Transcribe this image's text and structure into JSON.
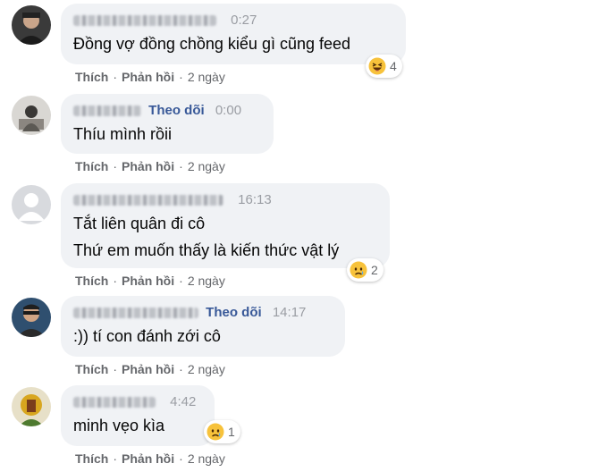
{
  "comments": [
    {
      "time": "0:27",
      "follow": "",
      "lines": [
        "Đồng vợ đồng chồng kiểu gì cũng feed"
      ],
      "reaction": {
        "icon": "laughing-emoji-icon",
        "count": "4"
      },
      "actions": {
        "like": "Thích",
        "reply": "Phản hồi",
        "age": "2 ngày"
      }
    },
    {
      "time": "0:00",
      "follow": "Theo dõi",
      "lines": [
        "Thíu mình rồii"
      ],
      "reaction": null,
      "actions": {
        "like": "Thích",
        "reply": "Phản hồi",
        "age": "2 ngày"
      }
    },
    {
      "time": "16:13",
      "follow": "",
      "lines": [
        "Tắt liên quân đi cô",
        "Thứ em muốn thấy là kiến thức vật lý"
      ],
      "reaction": {
        "icon": "sad-emoji-icon",
        "count": "2"
      },
      "actions": {
        "like": "Thích",
        "reply": "Phản hồi",
        "age": "2 ngày"
      }
    },
    {
      "time": "14:17",
      "follow": "Theo dõi",
      "lines": [
        ":)) tí con đánh zới cô"
      ],
      "reaction": null,
      "actions": {
        "like": "Thích",
        "reply": "Phản hồi",
        "age": "2 ngày"
      }
    },
    {
      "time": "4:42",
      "follow": "",
      "lines": [
        "minh vẹo kìa"
      ],
      "reaction": {
        "icon": "sad-emoji-icon",
        "count": "1"
      },
      "actions": {
        "like": "Thích",
        "reply": "Phản hồi",
        "age": "2 ngày"
      }
    }
  ],
  "colors": {
    "bubble": "#f0f2f5",
    "follow": "#385898",
    "meta": "#65676b",
    "timestamp": "#9a9da3"
  }
}
